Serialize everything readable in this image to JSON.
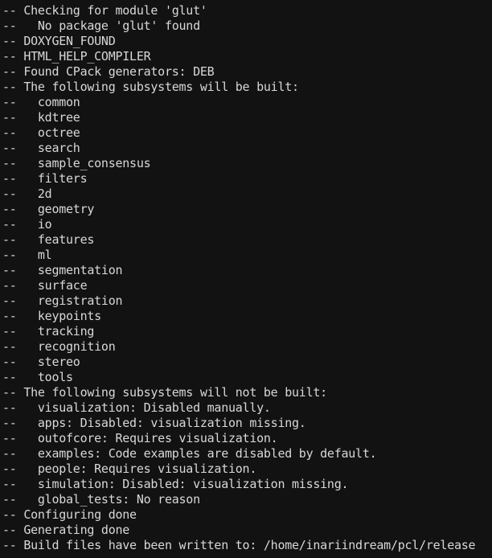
{
  "terminal": {
    "background_color": "#121212",
    "text_color": "#d8d8d8",
    "title": "Terminal",
    "lines": [
      "-- Checking for module 'glut'",
      "--   No package 'glut' found",
      "-- DOXYGEN_FOUND",
      "-- HTML_HELP_COMPILER",
      "-- Found CPack generators: DEB",
      "-- The following subsystems will be built:",
      "--   common",
      "--   kdtree",
      "--   octree",
      "--   search",
      "--   sample_consensus",
      "--   filters",
      "--   2d",
      "--   geometry",
      "--   io",
      "--   features",
      "--   ml",
      "--   segmentation",
      "--   surface",
      "--   registration",
      "--   keypoints",
      "--   tracking",
      "--   recognition",
      "--   stereo",
      "--   tools",
      "-- The following subsystems will not be built:",
      "--   visualization: Disabled manually.",
      "--   apps: Disabled: visualization missing.",
      "--   outofcore: Requires visualization.",
      "--   examples: Code examples are disabled by default.",
      "--   people: Requires visualization.",
      "--   simulation: Disabled: visualization missing.",
      "--   global_tests: No reason",
      "-- Configuring done",
      "-- Generating done",
      "-- Build files have been written to: /home/inariindream/pcl/release"
    ]
  }
}
